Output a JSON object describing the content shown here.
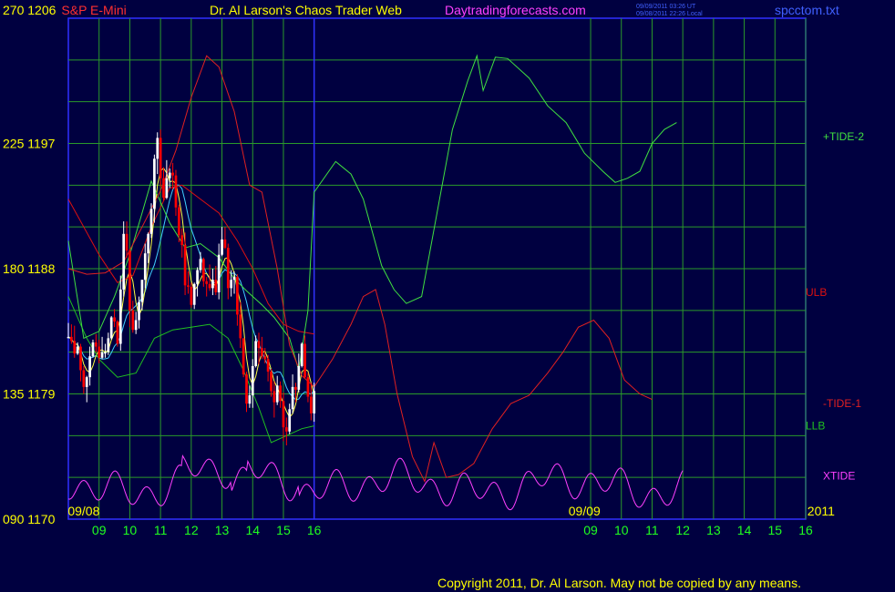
{
  "header": {
    "left_scale": "270  1206",
    "instrument": "S&P E-Mini",
    "title": "Dr. Al Larson's Chaos Trader Web",
    "site": "Daytradingforecasts.com",
    "timestamp_line1": "09/09/2011 03:26 UT",
    "timestamp_line2": "09/08/2011 22:26 Local",
    "filename": "spcctom.txt"
  },
  "footer": {
    "copyright": "Copyright 2011, Dr. Al Larson. May not be copied by any means."
  },
  "colors": {
    "background": "#000040",
    "grid": "#2a9a2a",
    "axis": "#3030ff",
    "price_down": "#ff0000",
    "price_up": "#ffffff",
    "ulb": "#dd1010",
    "llb": "#20c020",
    "tide2": "#40e040",
    "tide1": "#e02020",
    "xtide": "#ff40ff",
    "cyan_line": "#40d0ff",
    "yellow_line": "#ffff40"
  },
  "chart_data": {
    "type": "line",
    "y_left_labels": [
      {
        "value": 1170,
        "label": "090  1170"
      },
      {
        "value": 1179,
        "label": "135  1179"
      },
      {
        "value": 1188,
        "label": "180  1188"
      },
      {
        "value": 1197,
        "label": "225  1197"
      },
      {
        "value": 1206,
        "label": "270  1206"
      }
    ],
    "ylim": [
      1170,
      1206
    ],
    "x_hour_labels": [
      "09",
      "10",
      "11",
      "12",
      "13",
      "14",
      "15",
      "16",
      "09",
      "10",
      "11",
      "12",
      "13",
      "14",
      "15",
      "16"
    ],
    "x_hour_values": [
      9,
      10,
      11,
      12,
      13,
      14,
      15,
      16,
      25,
      26,
      27,
      28,
      29,
      30,
      31,
      32
    ],
    "xlim": [
      8,
      32
    ],
    "date_labels": [
      {
        "text": "09/08",
        "x": 8.5
      },
      {
        "text": "09/09",
        "x": 24.8
      },
      {
        "text": "2011",
        "x": 32.5
      }
    ],
    "now_x": 16,
    "price_candles": [
      [
        8.0,
        1183.1,
        1183.1,
        1184.1,
        1183.1
      ],
      [
        8.1,
        1183.1,
        1182.8,
        1184.0,
        1182.6
      ],
      [
        8.2,
        1182.8,
        1181.9,
        1183.9,
        1181.6
      ],
      [
        8.3,
        1181.9,
        1182.4,
        1182.7,
        1181.8
      ],
      [
        8.4,
        1182.4,
        1180.7,
        1182.6,
        1179.9
      ],
      [
        8.5,
        1180.7,
        1179.5,
        1181.0,
        1179.0
      ],
      [
        8.6,
        1179.5,
        1180.2,
        1180.3,
        1178.4
      ],
      [
        8.7,
        1180.2,
        1181.7,
        1182.4,
        1179.6
      ],
      [
        8.8,
        1181.7,
        1182.7,
        1182.9,
        1181.6
      ],
      [
        8.9,
        1182.7,
        1182.4,
        1183.3,
        1182.0
      ],
      [
        9.0,
        1182.4,
        1181.6,
        1182.9,
        1181.2
      ],
      [
        9.1,
        1181.6,
        1182.0,
        1183.1,
        1181.5
      ],
      [
        9.2,
        1182.0,
        1182.0,
        1182.6,
        1181.6
      ],
      [
        9.3,
        1182.0,
        1183.0,
        1183.4,
        1181.8
      ],
      [
        9.4,
        1183.0,
        1184.5,
        1184.6,
        1182.9
      ],
      [
        9.5,
        1184.5,
        1184.2,
        1185.1,
        1183.8
      ],
      [
        9.6,
        1184.2,
        1182.6,
        1184.3,
        1182.4
      ],
      [
        9.7,
        1182.6,
        1186.5,
        1187.5,
        1182.1
      ],
      [
        9.8,
        1186.5,
        1190.5,
        1191.4,
        1186.0
      ],
      [
        9.9,
        1190.5,
        1189.3,
        1191.4,
        1188.8
      ],
      [
        10.0,
        1189.3,
        1185.0,
        1189.4,
        1183.8
      ],
      [
        10.1,
        1185.0,
        1183.6,
        1185.7,
        1183.4
      ],
      [
        10.2,
        1183.6,
        1184.3,
        1184.9,
        1183.3
      ],
      [
        10.3,
        1184.3,
        1185.6,
        1186.0,
        1183.7
      ],
      [
        10.4,
        1185.6,
        1187.2,
        1187.2,
        1185.0
      ],
      [
        10.5,
        1187.2,
        1189.1,
        1189.8,
        1186.6
      ],
      [
        10.6,
        1189.1,
        1190.5,
        1190.6,
        1188.4
      ],
      [
        10.7,
        1190.5,
        1192.3,
        1192.7,
        1190.2
      ],
      [
        10.8,
        1192.3,
        1195.9,
        1196.2,
        1191.3
      ],
      [
        10.9,
        1195.9,
        1197.4,
        1197.8,
        1194.8
      ],
      [
        11.0,
        1197.4,
        1194.5,
        1198.0,
        1193.9
      ],
      [
        11.1,
        1194.5,
        1193.1,
        1195.3,
        1192.9
      ],
      [
        11.2,
        1193.1,
        1194.5,
        1195.8,
        1193.0
      ],
      [
        11.3,
        1194.5,
        1194.9,
        1195.2,
        1193.8
      ],
      [
        11.4,
        1194.9,
        1194.7,
        1195.6,
        1193.7
      ],
      [
        11.5,
        1194.7,
        1192.4,
        1195.1,
        1191.8
      ],
      [
        11.6,
        1192.4,
        1190.4,
        1192.6,
        1189.9
      ],
      [
        11.7,
        1190.4,
        1189.7,
        1190.9,
        1188.8
      ],
      [
        11.8,
        1189.7,
        1186.8,
        1190.6,
        1186.1
      ],
      [
        11.9,
        1186.8,
        1186.7,
        1187.8,
        1186.2
      ],
      [
        12.0,
        1186.7,
        1185.4,
        1187.0,
        1185.2
      ],
      [
        12.1,
        1185.4,
        1186.9,
        1187.0,
        1185.1
      ],
      [
        12.2,
        1186.9,
        1187.9,
        1188.1,
        1186.0
      ],
      [
        12.3,
        1187.9,
        1188.7,
        1189.2,
        1187.7
      ],
      [
        12.4,
        1188.7,
        1187.1,
        1188.8,
        1186.7
      ],
      [
        12.5,
        1187.1,
        1186.9,
        1187.4,
        1186.0
      ],
      [
        12.6,
        1186.9,
        1186.6,
        1188.3,
        1186.4
      ],
      [
        12.7,
        1186.6,
        1187.2,
        1188.0,
        1186.1
      ],
      [
        12.8,
        1187.2,
        1186.3,
        1188.2,
        1186.1
      ],
      [
        12.9,
        1186.3,
        1189.0,
        1189.8,
        1185.8
      ],
      [
        13.0,
        1189.0,
        1190.1,
        1191.0,
        1188.9
      ],
      [
        13.1,
        1190.1,
        1189.5,
        1191.0,
        1189.4
      ],
      [
        13.2,
        1189.5,
        1186.6,
        1189.8,
        1185.8
      ],
      [
        13.3,
        1186.6,
        1187.2,
        1187.9,
        1186.0
      ],
      [
        13.4,
        1187.2,
        1187.4,
        1187.8,
        1186.2
      ],
      [
        13.5,
        1187.4,
        1184.7,
        1187.6,
        1183.9
      ],
      [
        13.6,
        1184.7,
        1183.0,
        1185.6,
        1182.3
      ],
      [
        13.7,
        1183.0,
        1180.4,
        1183.0,
        1180.2
      ],
      [
        13.8,
        1180.4,
        1178.3,
        1180.6,
        1177.7
      ],
      [
        13.9,
        1178.3,
        1178.9,
        1179.6,
        1178.0
      ],
      [
        14.0,
        1178.9,
        1181.0,
        1181.5,
        1178.0
      ],
      [
        14.1,
        1181.0,
        1182.8,
        1183.2,
        1180.9
      ],
      [
        14.2,
        1182.8,
        1182.3,
        1183.4,
        1181.1
      ],
      [
        14.3,
        1182.3,
        1181.7,
        1183.1,
        1181.5
      ],
      [
        14.4,
        1181.7,
        1181.5,
        1182.3,
        1181.2
      ],
      [
        14.5,
        1181.5,
        1180.6,
        1181.8,
        1179.9
      ],
      [
        14.6,
        1180.6,
        1179.2,
        1180.8,
        1178.8
      ],
      [
        14.7,
        1179.2,
        1178.4,
        1179.9,
        1177.3
      ],
      [
        14.8,
        1178.4,
        1179.6,
        1180.3,
        1178.2
      ],
      [
        14.9,
        1179.6,
        1178.5,
        1179.9,
        1178.0
      ],
      [
        15.0,
        1178.5,
        1176.6,
        1179.1,
        1175.6
      ],
      [
        15.1,
        1176.6,
        1176.3,
        1177.3,
        1175.3
      ],
      [
        15.2,
        1176.3,
        1177.9,
        1178.3,
        1176.1
      ],
      [
        15.3,
        1177.9,
        1179.5,
        1180.4,
        1177.6
      ],
      [
        15.4,
        1179.5,
        1179.3,
        1179.8,
        1178.4
      ],
      [
        15.5,
        1179.3,
        1181.0,
        1181.9,
        1179.1
      ],
      [
        15.6,
        1181.0,
        1182.6,
        1182.7,
        1180.9
      ],
      [
        15.7,
        1182.6,
        1180.2,
        1183.2,
        1180.1
      ],
      [
        15.8,
        1180.2,
        1178.8,
        1180.5,
        1178.4
      ],
      [
        15.9,
        1178.8,
        1177.6,
        1179.8,
        1177.1
      ],
      [
        16.0,
        1177.6,
        1179.2,
        1179.8,
        1177.0
      ]
    ],
    "series": [
      {
        "name": "ULB",
        "label_y": 1183.3,
        "color_key": "ulb",
        "points": [
          [
            8,
            1193
          ],
          [
            8.5,
            1191
          ],
          [
            9,
            1189
          ],
          [
            9.6,
            1187
          ],
          [
            10.1,
            1187.5
          ],
          [
            10.7,
            1191
          ],
          [
            11.3,
            1193.8
          ],
          [
            11.7,
            1194
          ],
          [
            12.3,
            1193
          ],
          [
            12.9,
            1192
          ],
          [
            13.5,
            1190
          ],
          [
            14,
            1188
          ],
          [
            14.5,
            1185.5
          ],
          [
            15,
            1184
          ],
          [
            15.5,
            1183.5
          ],
          [
            16,
            1183.3
          ]
        ]
      },
      {
        "name": "LLB",
        "label_y": 1176.7,
        "color_key": "llb",
        "points": [
          [
            8,
            1186
          ],
          [
            8.6,
            1183
          ],
          [
            9,
            1181.5
          ],
          [
            9.6,
            1180.2
          ],
          [
            10.2,
            1180.5
          ],
          [
            10.8,
            1183
          ],
          [
            11.4,
            1183.6
          ],
          [
            12,
            1183.8
          ],
          [
            12.6,
            1184
          ],
          [
            13.2,
            1183
          ],
          [
            13.7,
            1180.7
          ],
          [
            14.2,
            1178
          ],
          [
            14.6,
            1175.5
          ],
          [
            15.1,
            1176
          ],
          [
            15.6,
            1176.5
          ],
          [
            16,
            1176.7
          ]
        ]
      },
      {
        "name": "+TIDE-2",
        "label_y": 1197.5,
        "color_key": "tide2",
        "points": [
          [
            8,
            1190
          ],
          [
            8.5,
            1183
          ],
          [
            9,
            1183.5
          ],
          [
            9.5,
            1186
          ],
          [
            10,
            1189
          ],
          [
            10.4,
            1192
          ],
          [
            10.7,
            1194.3
          ],
          [
            11.3,
            1191.3
          ],
          [
            11.8,
            1189.5
          ],
          [
            12.3,
            1189.8
          ],
          [
            12.9,
            1188.8
          ],
          [
            13.4,
            1187.3
          ],
          [
            13.8,
            1186.4
          ],
          [
            14.3,
            1185.4
          ],
          [
            14.7,
            1184.5
          ],
          [
            15.2,
            1183
          ],
          [
            15.5,
            1180.7
          ],
          [
            15.8,
            1185
          ],
          [
            16,
            1193.5
          ],
          [
            16.7,
            1195.7
          ],
          [
            17.2,
            1194.8
          ],
          [
            17.6,
            1193
          ],
          [
            18.2,
            1188.2
          ],
          [
            18.6,
            1186.5
          ],
          [
            19,
            1185.5
          ],
          [
            19.5,
            1186
          ],
          [
            20,
            1192
          ],
          [
            20.5,
            1198
          ],
          [
            21,
            1201.5
          ],
          [
            21.3,
            1203.3
          ],
          [
            21.5,
            1200.8
          ],
          [
            21.9,
            1203.2
          ],
          [
            22.3,
            1203.1
          ],
          [
            23,
            1201.7
          ],
          [
            23.6,
            1199.7
          ],
          [
            24.2,
            1198.5
          ],
          [
            24.8,
            1196.3
          ],
          [
            25.4,
            1195
          ],
          [
            25.8,
            1194.2
          ],
          [
            26.2,
            1194.5
          ],
          [
            26.6,
            1195
          ],
          [
            27,
            1197
          ],
          [
            27.4,
            1198
          ],
          [
            27.8,
            1198.5
          ]
        ]
      },
      {
        "name": "-TIDE-1",
        "label_y": 1178.3,
        "color_key": "tide1",
        "points": [
          [
            8,
            1188
          ],
          [
            8.6,
            1187.6
          ],
          [
            9.2,
            1187.7
          ],
          [
            9.8,
            1188.5
          ],
          [
            10.4,
            1191
          ],
          [
            11,
            1193.6
          ],
          [
            11.5,
            1196.5
          ],
          [
            12,
            1200.3
          ],
          [
            12.5,
            1203.3
          ],
          [
            12.9,
            1202.5
          ],
          [
            13.4,
            1199.3
          ],
          [
            13.9,
            1194
          ],
          [
            14.3,
            1193.5
          ],
          [
            14.8,
            1188
          ],
          [
            15.2,
            1182.5
          ],
          [
            15.6,
            1180.3
          ],
          [
            16,
            1179.5
          ],
          [
            16.6,
            1181.5
          ],
          [
            17.2,
            1184
          ],
          [
            17.6,
            1186
          ],
          [
            18,
            1186.5
          ],
          [
            18.3,
            1184
          ],
          [
            18.7,
            1179
          ],
          [
            19.2,
            1174.5
          ],
          [
            19.6,
            1172.7
          ],
          [
            19.9,
            1175.5
          ],
          [
            20.3,
            1173
          ],
          [
            20.7,
            1173.2
          ],
          [
            21.2,
            1174
          ],
          [
            21.8,
            1176.5
          ],
          [
            22.4,
            1178.3
          ],
          [
            23,
            1178.9
          ],
          [
            23.6,
            1180.5
          ],
          [
            24.1,
            1182
          ],
          [
            24.6,
            1183.8
          ],
          [
            25.1,
            1184.3
          ],
          [
            25.6,
            1183
          ],
          [
            26.1,
            1180
          ],
          [
            26.6,
            1179
          ],
          [
            27,
            1178.6
          ]
        ]
      },
      {
        "name": "XTIDE",
        "label_y": 1173.1,
        "color_key": "xtide",
        "points": []
      }
    ]
  },
  "right_labels": {
    "tide2": "+TIDE-2",
    "ulb": "ULB",
    "tide1": "-TIDE-1",
    "llb": "LLB",
    "xtide": "XTIDE"
  }
}
